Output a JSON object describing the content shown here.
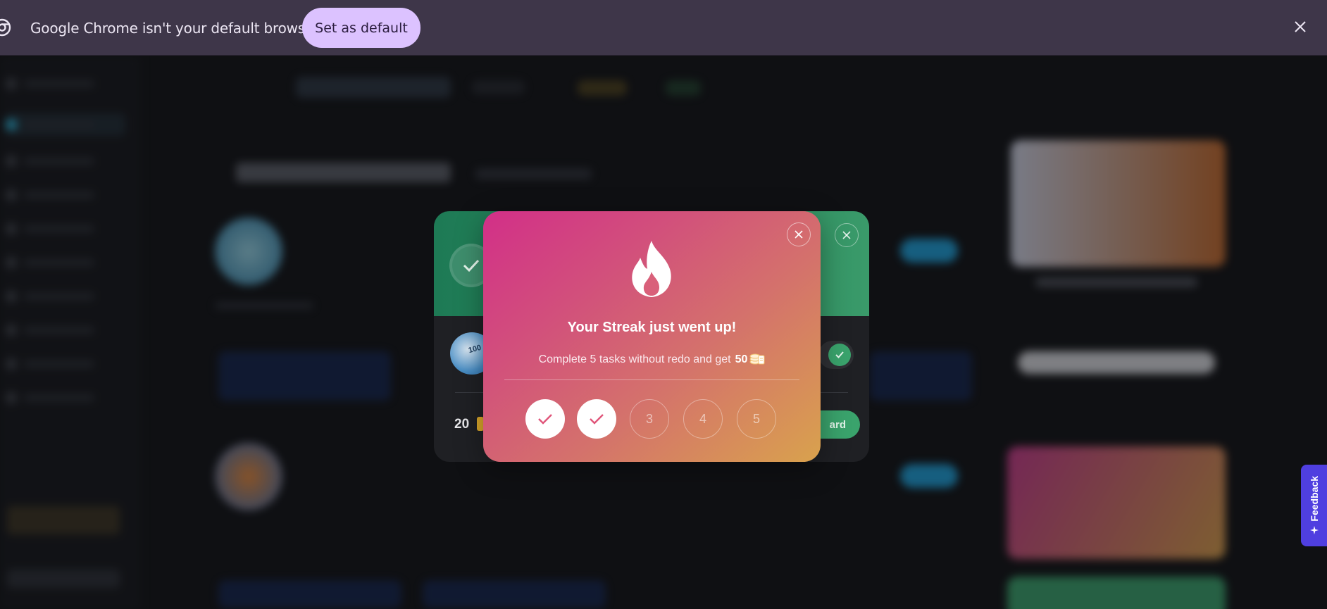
{
  "infobar": {
    "message": "Google Chrome isn't your default browser",
    "set_default_label": "Set as default",
    "close_symbol": "✕",
    "icons": {
      "browser": "chrome-icon",
      "close": "close-icon"
    }
  },
  "back_modal": {
    "amount": "20",
    "claim_label": "ard",
    "close_symbol": "✕"
  },
  "streak_modal": {
    "title": "Your Streak just went up!",
    "subtitle": "Complete 5 tasks without redo and get",
    "reward_amount": "50",
    "icons": {
      "header": "flame-icon",
      "reward": "coins-icon",
      "close": "close-icon",
      "done": "check-icon"
    },
    "steps": [
      {
        "label": "",
        "state": "done"
      },
      {
        "label": "",
        "state": "done"
      },
      {
        "label": "3",
        "state": "todo"
      },
      {
        "label": "4",
        "state": "todo"
      },
      {
        "label": "5",
        "state": "todo"
      }
    ],
    "colors": {
      "gradient_start": "#d22f88",
      "gradient_end": "#d9a24d",
      "check": "#e0557a"
    }
  },
  "feedback": {
    "label": "Feedback",
    "icon": "sparkle-icon",
    "color": "#4f3fe0"
  }
}
